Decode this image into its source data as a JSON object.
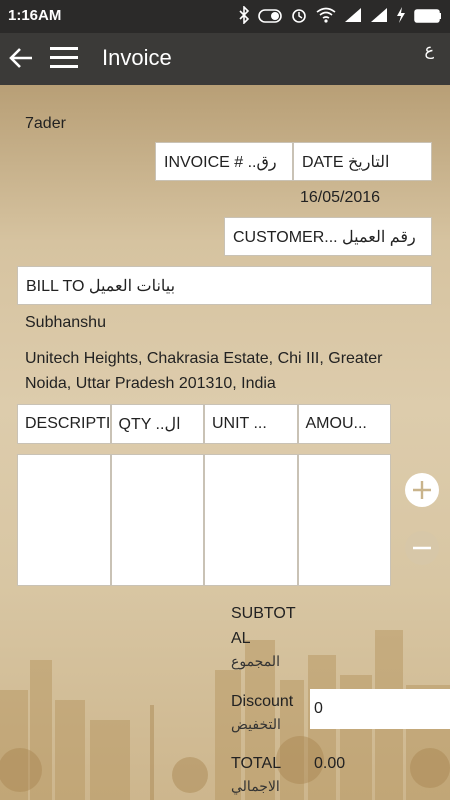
{
  "status_bar": {
    "time": "1:16AM"
  },
  "app_bar": {
    "title": "Invoice",
    "lang_toggle": "ع"
  },
  "invoice": {
    "company": "7ader",
    "invoice_no_label": "INVOICE # ..رق",
    "date_label": "DATE التاريخ",
    "date_value": "16/05/2016",
    "customer_label": "CUSTOMER... رقم العميل",
    "bill_to_label": "BILL TO بيانات العميل",
    "customer_name": "Subhanshu",
    "address_line1": "Unitech Heights, Chakrasia Estate, Chi III, Greater",
    "address_line2": "Noida, Uttar Pradesh 201310, India"
  },
  "table": {
    "headers": [
      "DESCRIPTIO...",
      "QTY   ..ال",
      "UNIT ...",
      "AMOU..."
    ]
  },
  "totals": {
    "subtotal_line1": "SUBTOT",
    "subtotal_line2": "AL",
    "subtotal_ar": "المجموع",
    "discount_label": "Discount",
    "discount_ar": "التخفيض",
    "discount_value": "0",
    "total_label": "TOTAL",
    "total_value": "0.00",
    "total_ar": "الاجمالي"
  }
}
